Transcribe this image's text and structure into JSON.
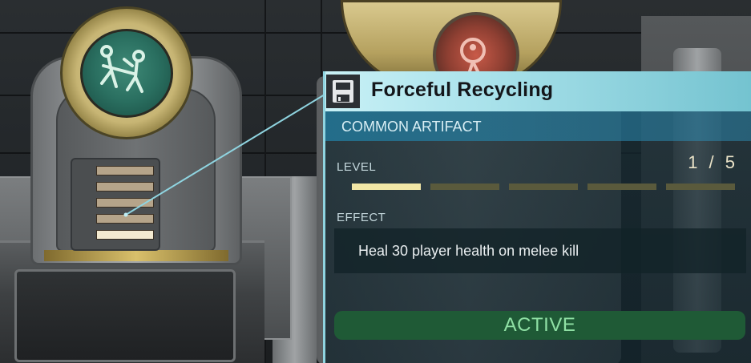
{
  "artifact": {
    "title": "Forceful Recycling",
    "rarity": "COMMON ARTIFACT",
    "level_label": "LEVEL",
    "level_value": "1 / 5",
    "level_current": 1,
    "level_max": 5,
    "effect_label": "EFFECT",
    "effect_text": "Heal 30 player health on melee kill",
    "status": "ACTIVE"
  },
  "colors": {
    "header": "#a8e1ea",
    "rarity_bar": "#206e8c",
    "level_on": "#f2e7a6",
    "level_off": "#5a5a3c",
    "active_bg": "#1f5a36",
    "active_text": "#8fe0a4"
  },
  "icons": {
    "artifact_icon": "floppy-disk-icon",
    "left_orb": "melee-kill-figures-icon",
    "right_orb": "red-artifact-icon"
  }
}
